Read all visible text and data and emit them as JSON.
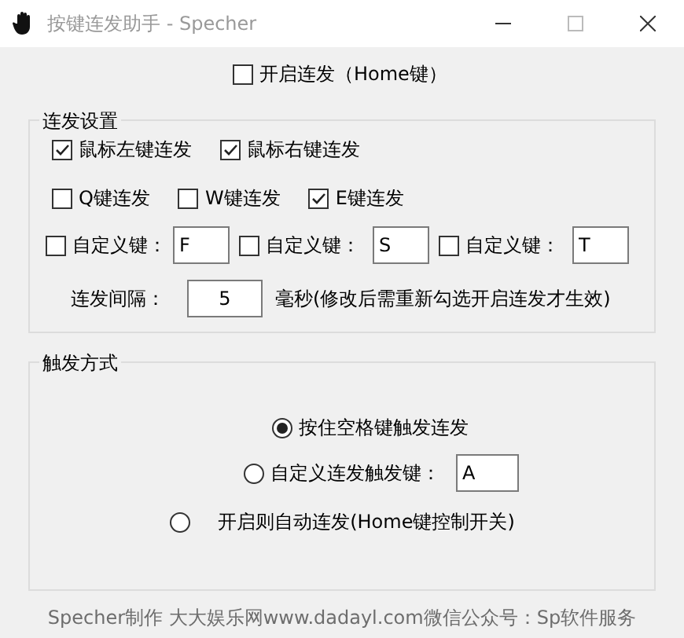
{
  "window": {
    "title": "按键连发助手 - Specher"
  },
  "master_toggle": {
    "label": "开启连发（Home键）",
    "checked": false
  },
  "burst_settings": {
    "title": "连发设置",
    "mouse": [
      {
        "label": "鼠标左键连发",
        "checked": true
      },
      {
        "label": "鼠标右键连发",
        "checked": true
      }
    ],
    "keys": [
      {
        "label": "Q键连发",
        "checked": false
      },
      {
        "label": "W键连发",
        "checked": false
      },
      {
        "label": "E键连发",
        "checked": true
      }
    ],
    "custom_keys": [
      {
        "label": "自定义键：",
        "checked": false,
        "value": "F"
      },
      {
        "label": "自定义键：",
        "checked": false,
        "value": "S"
      },
      {
        "label": "自定义键：",
        "checked": false,
        "value": "T"
      }
    ],
    "interval": {
      "label": "连发间隔：",
      "value": "5",
      "note": "毫秒(修改后需重新勾选开启连发才生效)"
    }
  },
  "trigger_mode": {
    "title": "触发方式",
    "options": [
      {
        "kind": "radio",
        "label": "按住空格键触发连发",
        "selected": true
      },
      {
        "kind": "radio_field",
        "label": "自定义连发触发键：",
        "selected": false,
        "value": "A"
      },
      {
        "kind": "radio_spaced",
        "label": "开启则自动连发(Home键控制开关)",
        "selected": false
      }
    ]
  },
  "footer": "Specher制作 大大娱乐网www.dadayl.com微信公众号：Sp软件服务"
}
